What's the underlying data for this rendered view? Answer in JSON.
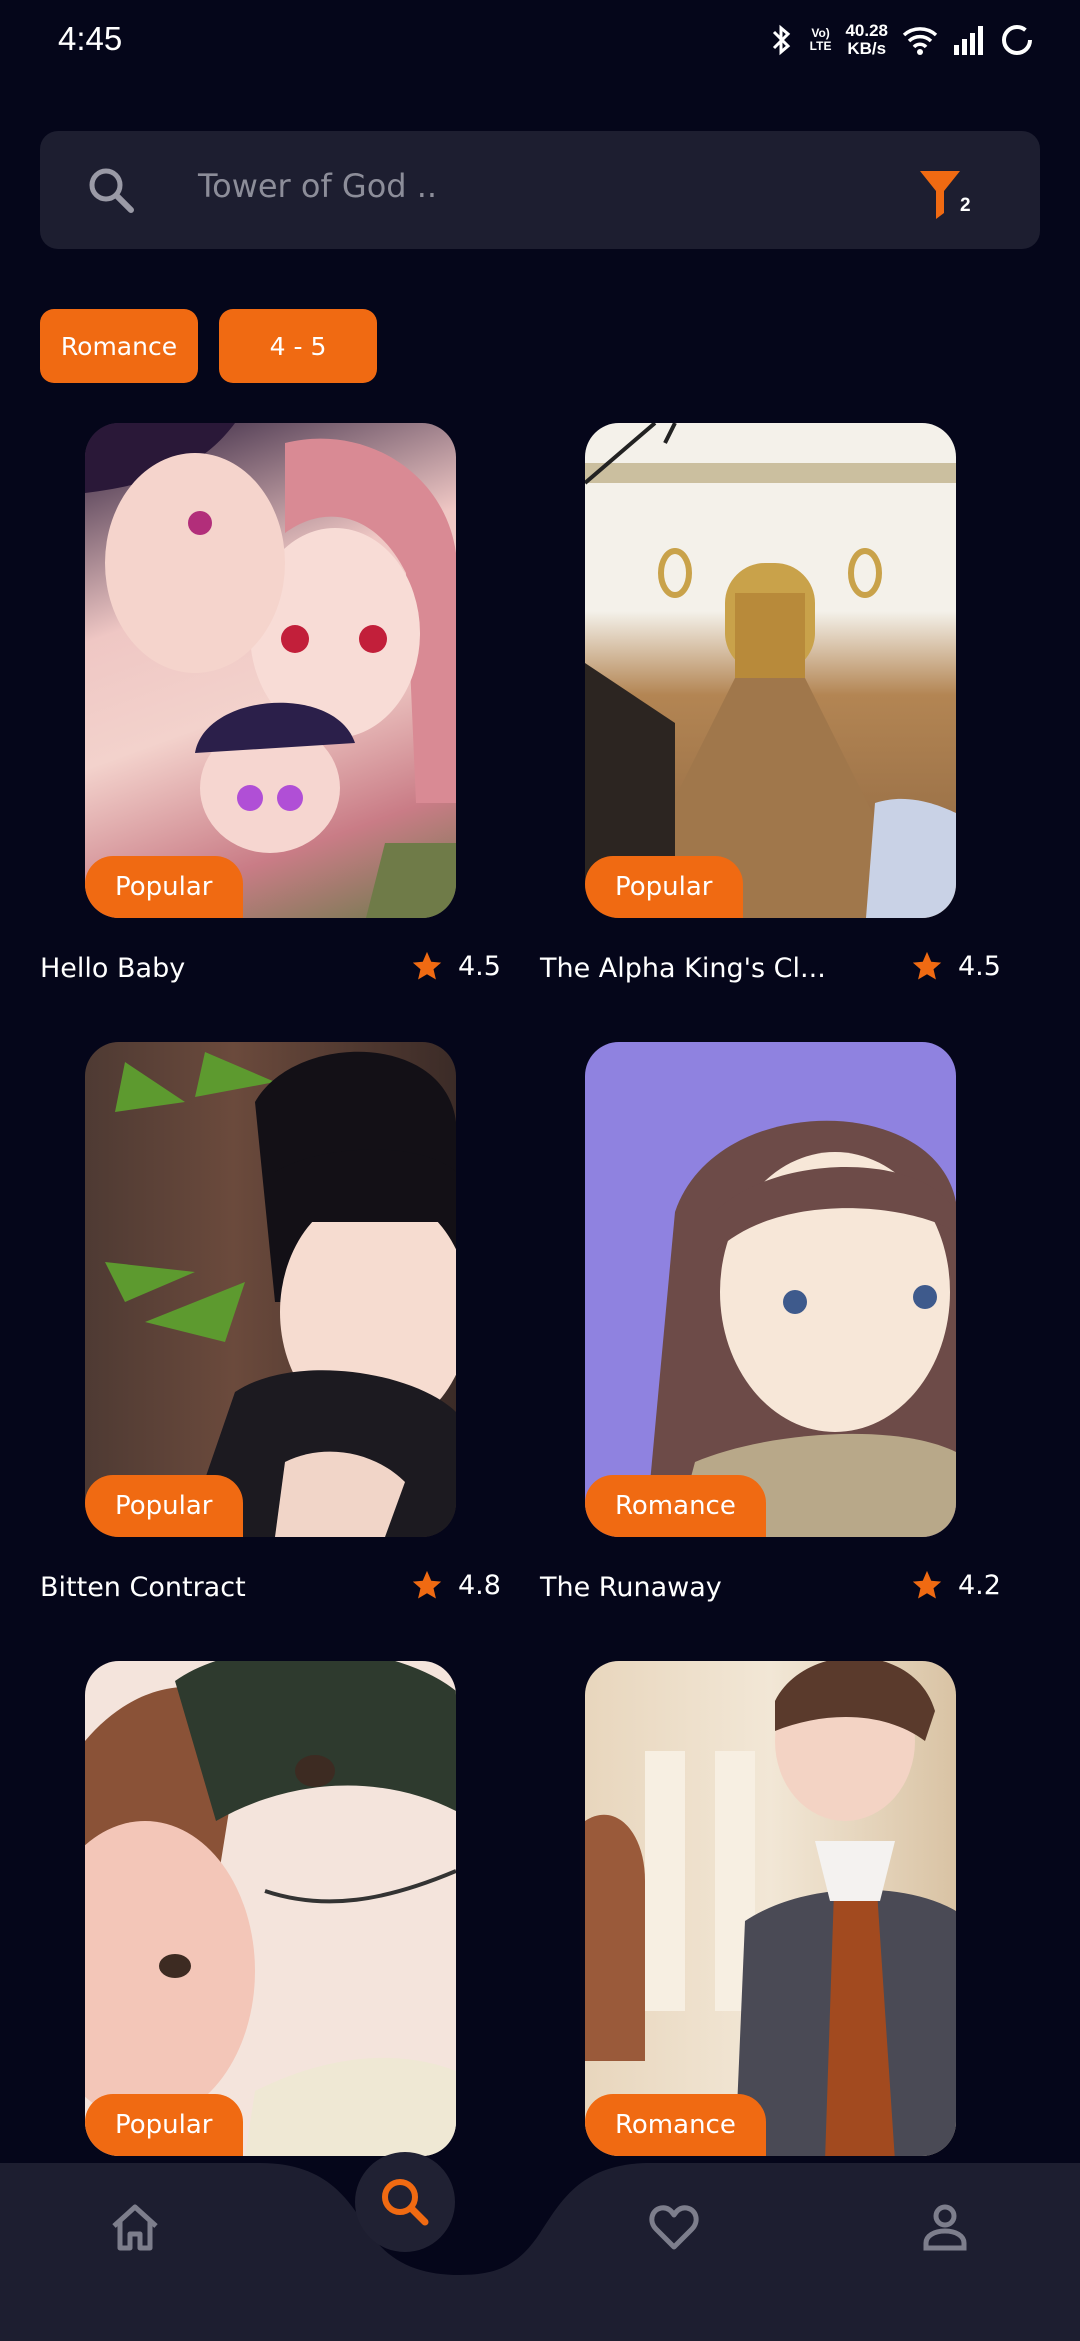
{
  "status_bar": {
    "time": "4:45",
    "speed": "40.28",
    "speed_unit": "KB/s",
    "net_top": "Vo)",
    "net_bottom": "LTE"
  },
  "search": {
    "placeholder": "Tower of God ..",
    "filter_count": "2"
  },
  "filters": [
    "Romance",
    "4 - 5"
  ],
  "comics": [
    {
      "title": "Hello Baby",
      "tag": "Popular",
      "rating": "4.5"
    },
    {
      "title": "The Alpha King's Cl...",
      "tag": "Popular",
      "rating": "4.5"
    },
    {
      "title": "Bitten Contract",
      "tag": "Popular",
      "rating": "4.8"
    },
    {
      "title": "The Runaway",
      "tag": "Romance",
      "rating": "4.2"
    },
    {
      "title": "",
      "tag": "Popular",
      "rating": ""
    },
    {
      "title": "",
      "tag": "Romance",
      "rating": ""
    }
  ],
  "nav": [
    "home-icon",
    "search-icon",
    "heart-icon",
    "profile-icon"
  ],
  "colors": {
    "background": "#05061a",
    "accent": "#f06a12",
    "surface": "#1d1e30"
  }
}
